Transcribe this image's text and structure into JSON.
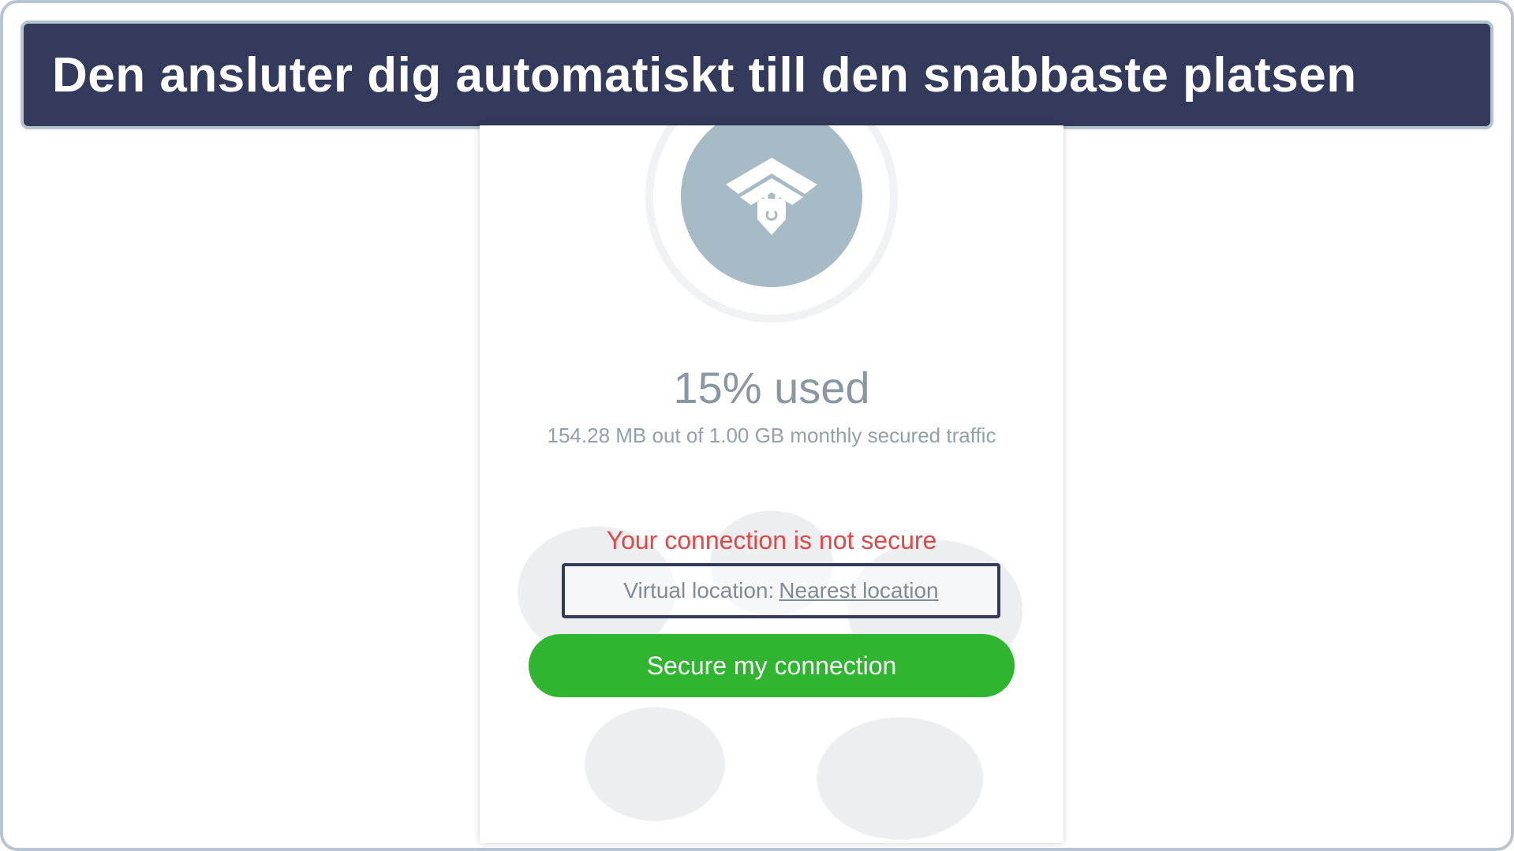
{
  "caption": {
    "text": "Den ansluter dig automatiskt till den snabbaste platsen"
  },
  "vpn": {
    "logo_icon": "vpn-shield-icon",
    "usage_title": "15% used",
    "usage_subtitle": "154.28 MB out of 1.00 GB monthly secured traffic",
    "connection_warning": "Your connection is not secure",
    "virtual_location_label": "Virtual location: ",
    "virtual_location_value": "Nearest location",
    "secure_button_label": "Secure my connection"
  },
  "colors": {
    "banner_bg": "#333a5c",
    "frame_border": "#b8c4d0",
    "warning_text": "#e14848",
    "cta_green": "#2fb52f",
    "muted_text": "#8b96a3"
  }
}
